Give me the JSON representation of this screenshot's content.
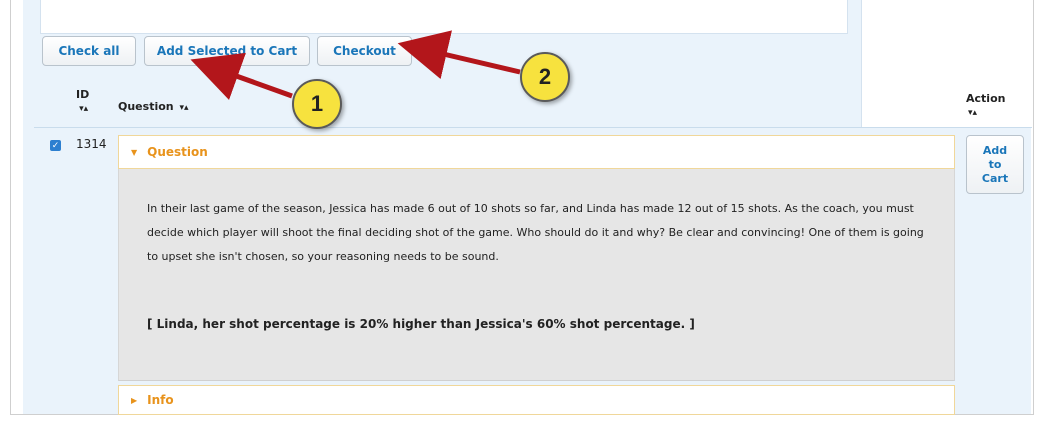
{
  "toolbar": {
    "check_all": "Check all",
    "add_selected": "Add Selected to Cart",
    "checkout": "Checkout"
  },
  "table": {
    "headers": {
      "id": "ID",
      "question": "Question",
      "action": "Action"
    },
    "sort_icon": "sort-arrows-icon",
    "row": {
      "checked": true,
      "id": "1314",
      "sections": {
        "question_label": "Question",
        "info_label": "Info"
      },
      "question_text": "In their last game of the season, Jessica has made 6 out of 10 shots so far, and Linda has made 12 out of 15 shots. As the coach, you must decide which player will shoot the final deciding shot of the game. Who should do it and why? Be clear and convincing! One of them is going to upset she isn't chosen, so your reasoning needs to be sound.",
      "answer_text": "[ Linda, her shot percentage is 20% higher than Jessica's 60% shot percentage. ]",
      "action_label": "Add to Cart"
    }
  },
  "annotations": {
    "callout_1": "1",
    "callout_2": "2",
    "callout_color": "#f7e23e",
    "arrow_color": "#b3161b"
  }
}
